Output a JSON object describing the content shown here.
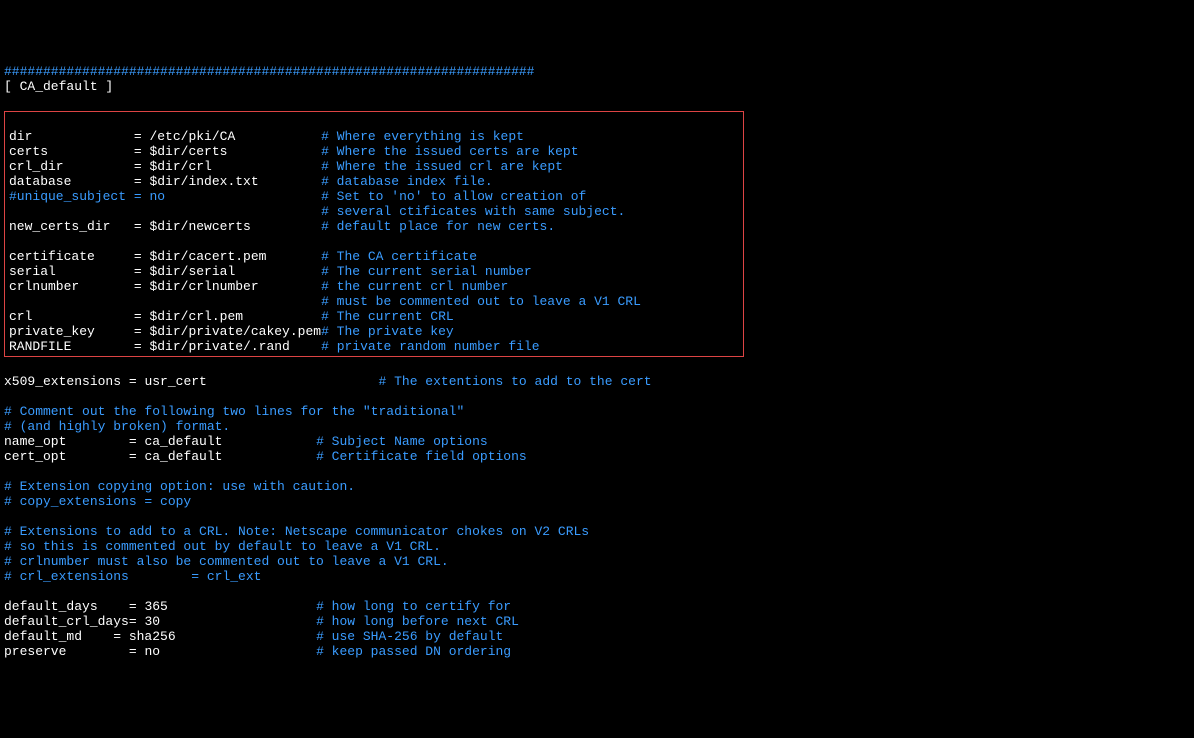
{
  "sep_line": "####################################################################",
  "section": "[ CA_default ]",
  "boxed": [
    {
      "key": "dir",
      "val": "/etc/pki/CA",
      "comment": "# Where everything is kept"
    },
    {
      "key": "certs",
      "val": "$dir/certs",
      "comment": "# Where the issued certs are kept"
    },
    {
      "key": "crl_dir",
      "val": "$dir/crl",
      "comment": "# Where the issued crl are kept"
    },
    {
      "key": "database",
      "val": "$dir/index.txt",
      "comment": "# database index file."
    },
    {
      "key": "#unique_subject",
      "val": "no",
      "comment": "# Set to 'no' to allow creation of",
      "all_comment": true
    },
    {
      "key": "",
      "val": "",
      "comment": "# several ctificates with same subject.",
      "indent_only": true
    },
    {
      "key": "new_certs_dir",
      "val": "$dir/newcerts",
      "comment": "# default place for new certs."
    },
    {
      "blank": true
    },
    {
      "key": "certificate",
      "val": "$dir/cacert.pem",
      "comment": "# The CA certificate"
    },
    {
      "key": "serial",
      "val": "$dir/serial",
      "comment": "# The current serial number"
    },
    {
      "key": "crlnumber",
      "val": "$dir/crlnumber",
      "comment": "# the current crl number"
    },
    {
      "key": "",
      "val": "",
      "comment": "# must be commented out to leave a V1 CRL",
      "indent_only": true
    },
    {
      "key": "crl",
      "val": "$dir/crl.pem",
      "comment": "# The current CRL"
    },
    {
      "key": "private_key",
      "val": "$dir/private/cakey.pem",
      "comment": "# The private key",
      "tight": true
    },
    {
      "key": "RANDFILE",
      "val": "$dir/private/.rand",
      "comment": "# private random number file"
    }
  ],
  "after": [
    {
      "key": "x509_extensions",
      "val": "usr_cert",
      "comment": "# The extentions to add to the cert",
      "wide": true
    },
    {
      "blank": true
    },
    {
      "full_comment": "# Comment out the following two lines for the \"traditional\""
    },
    {
      "full_comment": "# (and highly broken) format."
    },
    {
      "key": "name_opt",
      "val": "ca_default",
      "comment": "# Subject Name options"
    },
    {
      "key": "cert_opt",
      "val": "ca_default",
      "comment": "# Certificate field options"
    },
    {
      "blank": true
    },
    {
      "full_comment": "# Extension copying option: use with caution."
    },
    {
      "full_comment": "# copy_extensions = copy"
    },
    {
      "blank": true
    },
    {
      "full_comment": "# Extensions to add to a CRL. Note: Netscape communicator chokes on V2 CRLs"
    },
    {
      "full_comment": "# so this is commented out by default to leave a V1 CRL."
    },
    {
      "full_comment": "# crlnumber must also be commented out to leave a V1 CRL."
    },
    {
      "full_comment": "# crl_extensions        = crl_ext"
    },
    {
      "blank": true
    },
    {
      "key": "default_days",
      "val": "365",
      "comment": "# how long to certify for"
    },
    {
      "key": "default_crl_days",
      "val": "30",
      "comment": "# how long before next CRL",
      "noeqspace": true
    },
    {
      "key": "default_md",
      "val": "sha256",
      "comment": "# use SHA-256 by default",
      "short": true
    },
    {
      "key": "preserve",
      "val": "no",
      "comment": "# keep passed DN ordering"
    }
  ]
}
